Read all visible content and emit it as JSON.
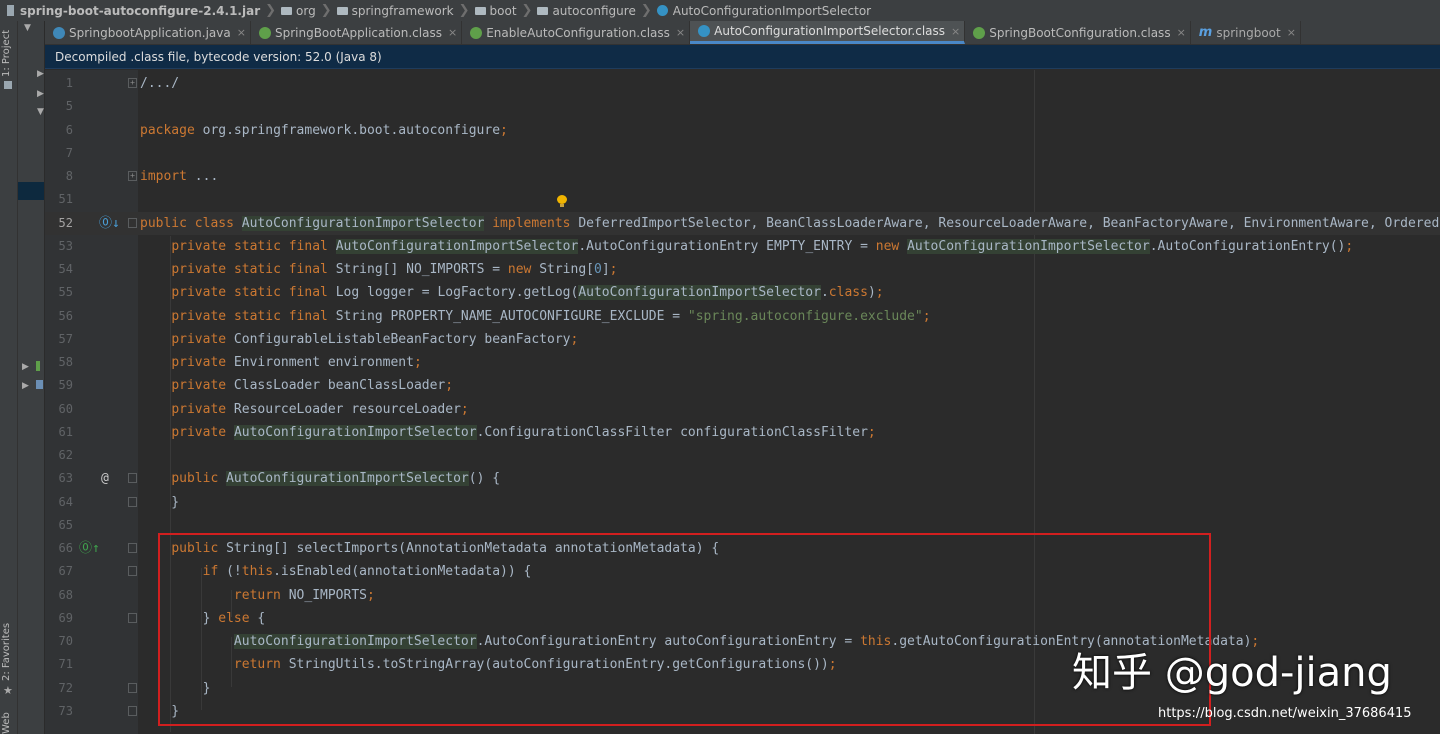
{
  "breadcrumb": [
    "spring-boot-autoconfigure-2.4.1.jar",
    "org",
    "springframework",
    "boot",
    "autoconfigure",
    "AutoConfigurationImportSelector"
  ],
  "left_strip": {
    "project_label": "1: Project",
    "favorites_label": "2: Favorites",
    "web_label": "Web"
  },
  "tabs": [
    {
      "label": "SpringbootApplication.java",
      "icon": "java-class-icon",
      "active": false
    },
    {
      "label": "SpringBootApplication.class",
      "icon": "spring-class-icon",
      "active": false
    },
    {
      "label": "EnableAutoConfiguration.class",
      "icon": "spring-class-icon",
      "active": false
    },
    {
      "label": "AutoConfigurationImportSelector.class",
      "icon": "class-icon",
      "active": true
    },
    {
      "label": "SpringBootConfiguration.class",
      "icon": "spring-class-icon",
      "active": false
    },
    {
      "label": "springboot",
      "icon": "maven-module-icon",
      "active": false
    }
  ],
  "tab_close_glyph": "×",
  "info_bar": "Decompiled .class file, bytecode version: 52.0 (Java 8)",
  "editor": {
    "current_line": "52",
    "lines": [
      {
        "n": "1",
        "code": "/.../"
      },
      {
        "n": "5",
        "code": ""
      },
      {
        "n": "6",
        "code": "package org.springframework.boot.autoconfigure;"
      },
      {
        "n": "7",
        "code": ""
      },
      {
        "n": "8",
        "code": "import ..."
      },
      {
        "n": "51",
        "code": ""
      },
      {
        "n": "52",
        "code": "public class AutoConfigurationImportSelector implements DeferredImportSelector, BeanClassLoaderAware, ResourceLoaderAware, BeanFactoryAware, EnvironmentAware, Ordered {"
      },
      {
        "n": "53",
        "code": "    private static final AutoConfigurationImportSelector.AutoConfigurationEntry EMPTY_ENTRY = new AutoConfigurationImportSelector.AutoConfigurationEntry();"
      },
      {
        "n": "54",
        "code": "    private static final String[] NO_IMPORTS = new String[0];"
      },
      {
        "n": "55",
        "code": "    private static final Log logger = LogFactory.getLog(AutoConfigurationImportSelector.class);"
      },
      {
        "n": "56",
        "code": "    private static final String PROPERTY_NAME_AUTOCONFIGURE_EXCLUDE = \"spring.autoconfigure.exclude\";"
      },
      {
        "n": "57",
        "code": "    private ConfigurableListableBeanFactory beanFactory;"
      },
      {
        "n": "58",
        "code": "    private Environment environment;"
      },
      {
        "n": "59",
        "code": "    private ClassLoader beanClassLoader;"
      },
      {
        "n": "60",
        "code": "    private ResourceLoader resourceLoader;"
      },
      {
        "n": "61",
        "code": "    private AutoConfigurationImportSelector.ConfigurationClassFilter configurationClassFilter;"
      },
      {
        "n": "62",
        "code": ""
      },
      {
        "n": "63",
        "code": "    public AutoConfigurationImportSelector() {"
      },
      {
        "n": "64",
        "code": "    }"
      },
      {
        "n": "65",
        "code": ""
      },
      {
        "n": "66",
        "code": "    public String[] selectImports(AnnotationMetadata annotationMetadata) {"
      },
      {
        "n": "67",
        "code": "        if (!this.isEnabled(annotationMetadata)) {"
      },
      {
        "n": "68",
        "code": "            return NO_IMPORTS;"
      },
      {
        "n": "69",
        "code": "        } else {"
      },
      {
        "n": "70",
        "code": "            AutoConfigurationImportSelector.AutoConfigurationEntry autoConfigurationEntry = this.getAutoConfigurationEntry(annotationMetadata);"
      },
      {
        "n": "71",
        "code": "            return StringUtils.toStringArray(autoConfigurationEntry.getConfigurations());"
      },
      {
        "n": "72",
        "code": "        }"
      },
      {
        "n": "73",
        "code": "    }"
      }
    ]
  },
  "watermark": "知乎 @god-jiang",
  "credit": "https://blog.csdn.net/weixin_37686415",
  "colors": {
    "keyword": "#cc7832",
    "string": "#6a8759",
    "number": "#6897bb",
    "highlight_box": "#d21f1f",
    "accent_tab": "#4a88c7"
  }
}
